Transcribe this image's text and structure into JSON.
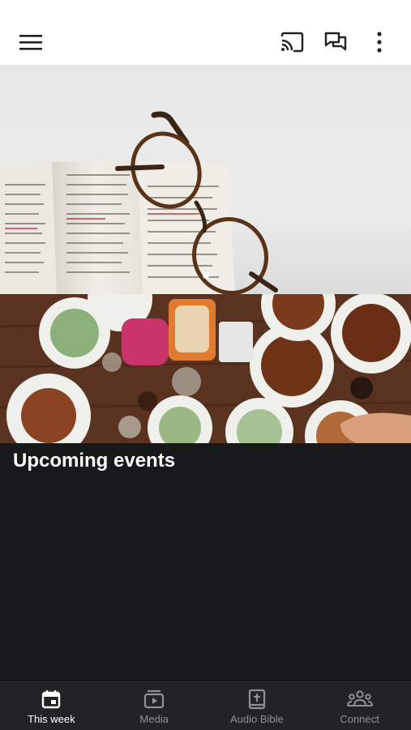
{
  "header": {
    "menu_icon": "hamburger-menu-icon",
    "cast_icon": "cast-icon",
    "chat_icon": "chat-bubbles-icon",
    "more_icon": "more-vertical-icon"
  },
  "carousel": {
    "slide_count": 2,
    "active_index": 0,
    "slides": [
      "bible-with-glasses-photo",
      "dinner-table-photo"
    ]
  },
  "main": {
    "section_title": "Upcoming events"
  },
  "bottom_nav": {
    "items": [
      {
        "label": "This week",
        "icon": "calendar-icon",
        "active": true
      },
      {
        "label": "Media",
        "icon": "play-video-icon",
        "active": false
      },
      {
        "label": "Audio Bible",
        "icon": "bible-cross-icon",
        "active": false
      },
      {
        "label": "Connect",
        "icon": "people-group-icon",
        "active": false
      }
    ]
  },
  "colors": {
    "background": "#18191b",
    "nav_background": "#222325",
    "nav_inactive": "#8e9095",
    "nav_active": "#ffffff"
  }
}
